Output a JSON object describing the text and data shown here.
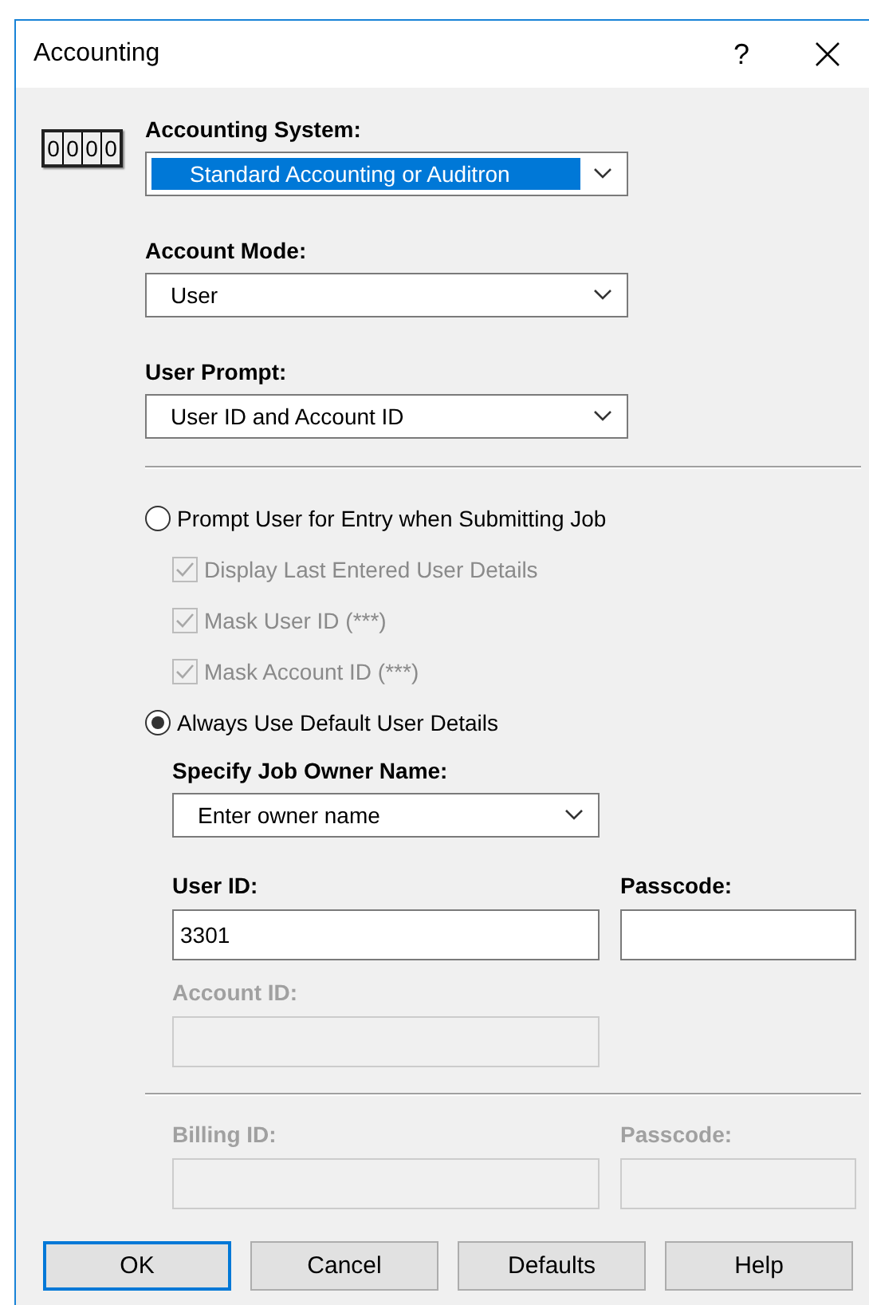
{
  "window": {
    "title": "Accounting",
    "help": "?"
  },
  "counter": [
    "0",
    "0",
    "0",
    "0"
  ],
  "dropdowns": [
    {
      "label": "Accounting System:",
      "value": "Standard Accounting or Auditron",
      "highlighted": true
    },
    {
      "label": "Account Mode:",
      "value": "User",
      "highlighted": false
    },
    {
      "label": "User Prompt:",
      "value": "User ID and Account ID",
      "highlighted": false
    }
  ],
  "modes": [
    {
      "label": "Prompt User for Entry when Submitting Job",
      "selected": false,
      "children": [
        {
          "label": "Display Last Entered User Details",
          "checked": true,
          "disabled": true
        },
        {
          "label": "Mask User ID (***)",
          "checked": true,
          "disabled": true
        },
        {
          "label": "Mask Account ID (***)",
          "checked": true,
          "disabled": true
        }
      ]
    },
    {
      "label": "Always Use Default User Details",
      "selected": true
    }
  ],
  "owner": {
    "label": "Specify Job Owner Name:",
    "value": "Enter owner name"
  },
  "user_fields": [
    {
      "label": "User ID:",
      "value": "3301",
      "disabled": false
    },
    {
      "label": "Passcode:",
      "disabled": false
    }
  ],
  "account_fields": [
    {
      "label": "Account ID:",
      "disabled": true
    }
  ],
  "billing_fields": [
    {
      "label": "Billing ID:",
      "disabled": true
    },
    {
      "label": "Passcode:",
      "disabled": true
    }
  ],
  "buttons": [
    {
      "label": "OK",
      "default": true
    },
    {
      "label": "Cancel",
      "default": false
    },
    {
      "label": "Defaults",
      "default": false
    },
    {
      "label": "Help",
      "default": false
    }
  ]
}
